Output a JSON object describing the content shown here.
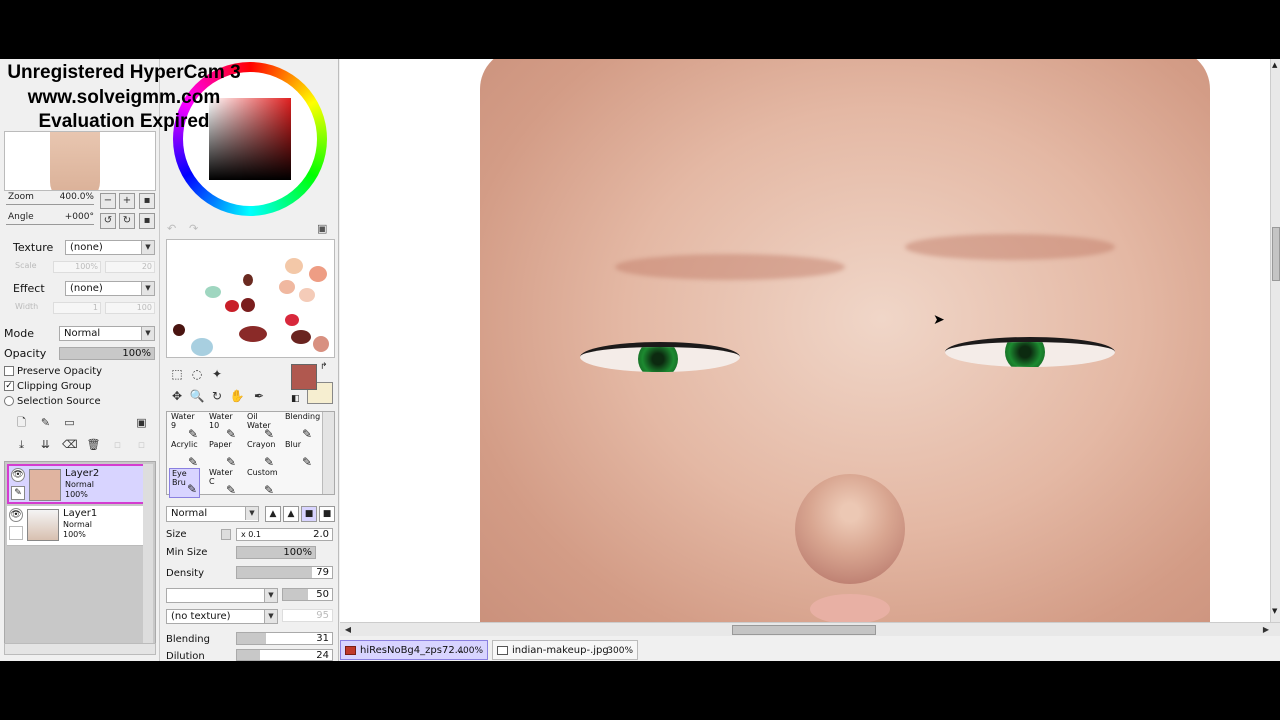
{
  "watermark": {
    "line1": "Unregistered HyperCam 3",
    "line2": "www.solveigmm.com",
    "line3": "Evaluation Expired"
  },
  "navigator": {
    "zoom_label": "Zoom",
    "zoom_value": "400.0%",
    "angle_label": "Angle",
    "angle_value": "+000°"
  },
  "layer_props": {
    "texture_label": "Texture",
    "texture_value": "(none)",
    "scale_label": "Scale",
    "scale_value": "100%",
    "scale_num": "20",
    "effect_label": "Effect",
    "effect_value": "(none)",
    "width_label": "Width",
    "width_value": "1",
    "width_num": "100",
    "mode_label": "Mode",
    "mode_value": "Normal",
    "opacity_label": "Opacity",
    "opacity_value": "100%",
    "preserve_opacity": "Preserve Opacity",
    "clipping_group": "Clipping Group",
    "selection_source": "Selection Source"
  },
  "layers": [
    {
      "name": "Layer2",
      "mode": "Normal",
      "opacity": "100%"
    },
    {
      "name": "Layer1",
      "mode": "Normal",
      "opacity": "100%"
    }
  ],
  "brushes": {
    "cells": [
      {
        "label": "Water",
        "size": "9"
      },
      {
        "label": "Water",
        "size": "10"
      },
      {
        "label": "Oil Water",
        "size": ""
      },
      {
        "label": "Blending",
        "size": ""
      },
      {
        "label": "Acrylic",
        "size": ""
      },
      {
        "label": "Paper",
        "size": ""
      },
      {
        "label": "Crayon",
        "size": ""
      },
      {
        "label": "Blur",
        "size": ""
      },
      {
        "label": "Eye Bru",
        "size": ""
      },
      {
        "label": "Water C",
        "size": ""
      },
      {
        "label": "Custom",
        "size": ""
      }
    ]
  },
  "brush_params": {
    "blend_mode": "Normal",
    "size_label": "Size",
    "size_mult": "x 0.1",
    "size_value": "2.0",
    "min_size_label": "Min Size",
    "min_size_value": "100%",
    "density_label": "Density",
    "density_value": "79",
    "density_pct": 79,
    "shape_value": "50",
    "shape_pct": 50,
    "texture_value": "(no texture)",
    "texture_num": "95",
    "blending_label": "Blending",
    "blending_value": "31",
    "blending_pct": 31,
    "dilution_label": "Dilution",
    "dilution_value": "24",
    "dilution_pct": 24
  },
  "tabs": [
    {
      "name": "hiResNoBg4_zps72...",
      "zoom": "400%",
      "active": true
    },
    {
      "name": "indian-makeup-.jpg",
      "zoom": "300%",
      "active": false
    }
  ],
  "colors": {
    "main": "#b0584f",
    "sub": "#f6eed0",
    "selection": "#d8d4ff",
    "selected_border": "#d43cd0"
  }
}
